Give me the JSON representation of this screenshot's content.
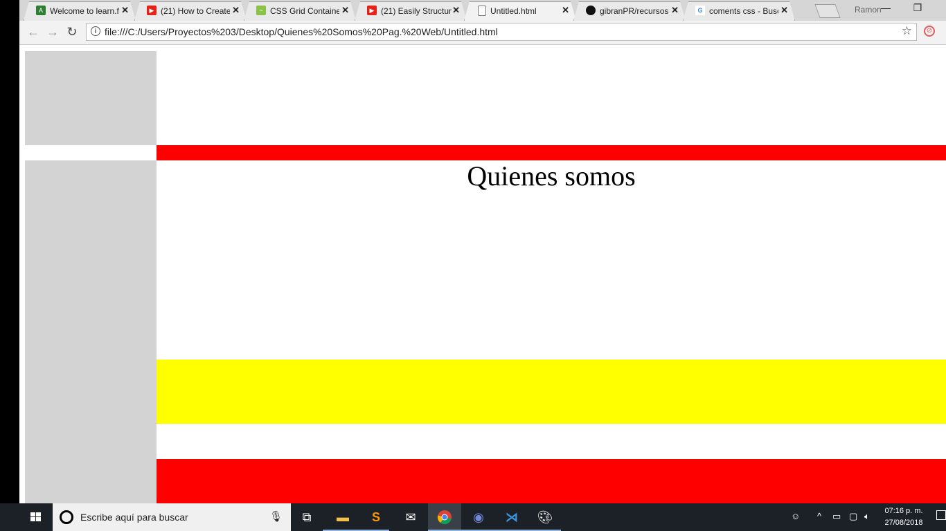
{
  "browser": {
    "tabs": [
      {
        "title": "Welcome to learn.f",
        "favicon_color": "#2e7d32",
        "favicon_glyph": "A",
        "active": false
      },
      {
        "title": "(21) How to Create",
        "favicon_color": "#e62117",
        "favicon_glyph": "▶",
        "active": false
      },
      {
        "title": "CSS Grid Containe",
        "favicon_color": "#8bc34a",
        "favicon_glyph": "~",
        "active": false
      },
      {
        "title": "(21) Easily Structur",
        "favicon_color": "#e62117",
        "favicon_glyph": "▶",
        "active": false
      },
      {
        "title": "Untitled.html",
        "favicon_color": "#ffffff",
        "favicon_glyph": "",
        "active": true
      },
      {
        "title": "gibranPR/recursos",
        "favicon_color": "#111111",
        "favicon_glyph": "●",
        "active": false
      },
      {
        "title": "coments css - Busc",
        "favicon_color": "#ffffff",
        "favicon_glyph": "G",
        "active": false
      }
    ],
    "profile_name": "Ramon",
    "address_url": "file:///C:/Users/Proyectos%203/Desktop/Quienes%20Somos%20Pag.%20Web/Untitled.html"
  },
  "page": {
    "heading": "Quienes somos",
    "colors": {
      "gray": "#d3d3d3",
      "red": "#ff0000",
      "yellow": "#ffff00"
    }
  },
  "taskbar": {
    "search_placeholder": "Escribe aquí para buscar",
    "time": "07:16 p. m.",
    "date": "27/08/2018",
    "apps": [
      "task-view-icon",
      "file-explorer-icon",
      "sublime-text-icon",
      "mail-icon",
      "chrome-icon",
      "discord-icon",
      "vscode-icon",
      "paint-icon"
    ]
  }
}
